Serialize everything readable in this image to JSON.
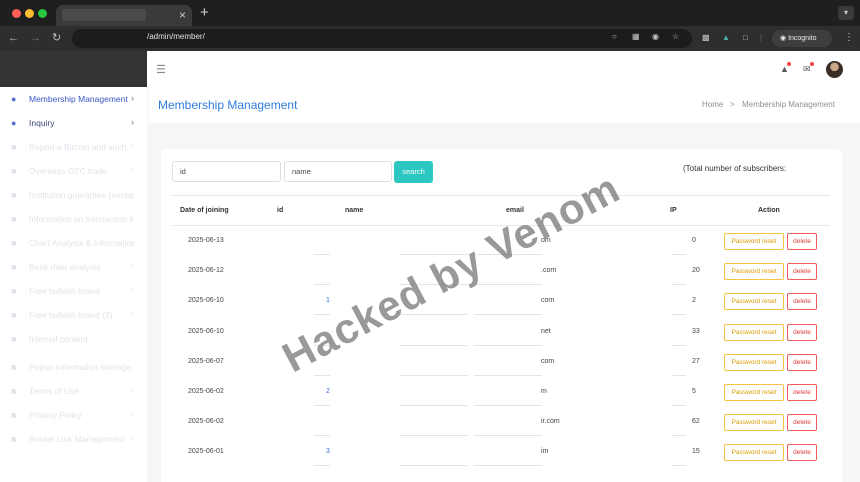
{
  "browser": {
    "url": "/admin/member/",
    "incognito_label": "Incognito",
    "tab_close": "×",
    "new_tab": "+"
  },
  "sidebar": {
    "items": [
      {
        "label": "Membership Management",
        "state": "active"
      },
      {
        "label": "Inquiry",
        "state": "normal"
      },
      {
        "label": "Report a Bitcoin and such",
        "state": "faded"
      },
      {
        "label": "Overseas OTC trade",
        "state": "faded"
      },
      {
        "label": "Institution guarantee (exception)",
        "state": "faded"
      },
      {
        "label": "Information on transaction breakdown",
        "state": "faded"
      },
      {
        "label": "Chart Analysis & Information",
        "state": "faded"
      },
      {
        "label": "Bank data analysis",
        "state": "faded"
      },
      {
        "label": "Free bulletin board",
        "state": "faded"
      },
      {
        "label": "Free bulletin board (2)",
        "state": "faded"
      },
      {
        "label": "Internal content",
        "state": "faded"
      },
      {
        "label": "Popup information manage",
        "state": "faded"
      },
      {
        "label": "Terms of Use",
        "state": "faded"
      },
      {
        "label": "Privacy Policy",
        "state": "faded"
      },
      {
        "label": "Router Link Management",
        "state": "faded"
      }
    ]
  },
  "header": {
    "page_title": "Membership Management",
    "breadcrumb_home": "Home",
    "breadcrumb_sep": ">",
    "breadcrumb_current": "Membership Management"
  },
  "filters": {
    "id_value": "id",
    "name_value": "name",
    "search_label": "search",
    "total_label": "(Total number of subscribers:"
  },
  "table": {
    "columns": [
      "Date of joining",
      "id",
      "name",
      "email",
      "IP",
      "Action"
    ],
    "rows": [
      {
        "date": "2025-06-13",
        "id": "",
        "email": "om",
        "ip": "0"
      },
      {
        "date": "2025-06-12",
        "id": "",
        "email": ".com",
        "ip": "20"
      },
      {
        "date": "2025-06-10",
        "id": "1",
        "email": "com",
        "ip": "2"
      },
      {
        "date": "2025-06-10",
        "id": "",
        "email": "net",
        "ip": "33"
      },
      {
        "date": "2025-06-07",
        "id": "",
        "email": "com",
        "ip": "27"
      },
      {
        "date": "2025-06-02",
        "id": "2",
        "email": "m",
        "ip": "5"
      },
      {
        "date": "2025-06-02",
        "id": "",
        "email": "ir.com",
        "ip": "62"
      },
      {
        "date": "2025-06-01",
        "id": "3",
        "email": "im",
        "ip": "15"
      }
    ],
    "reset_label": "Password reset",
    "delete_label": "delete"
  },
  "watermark": "Hacked by Venom",
  "colors": {
    "accent_blue": "#2f7bd9",
    "search_teal": "#2bc7c0",
    "reset_yellow": "#f5c242",
    "delete_red": "#ef5b5b"
  }
}
